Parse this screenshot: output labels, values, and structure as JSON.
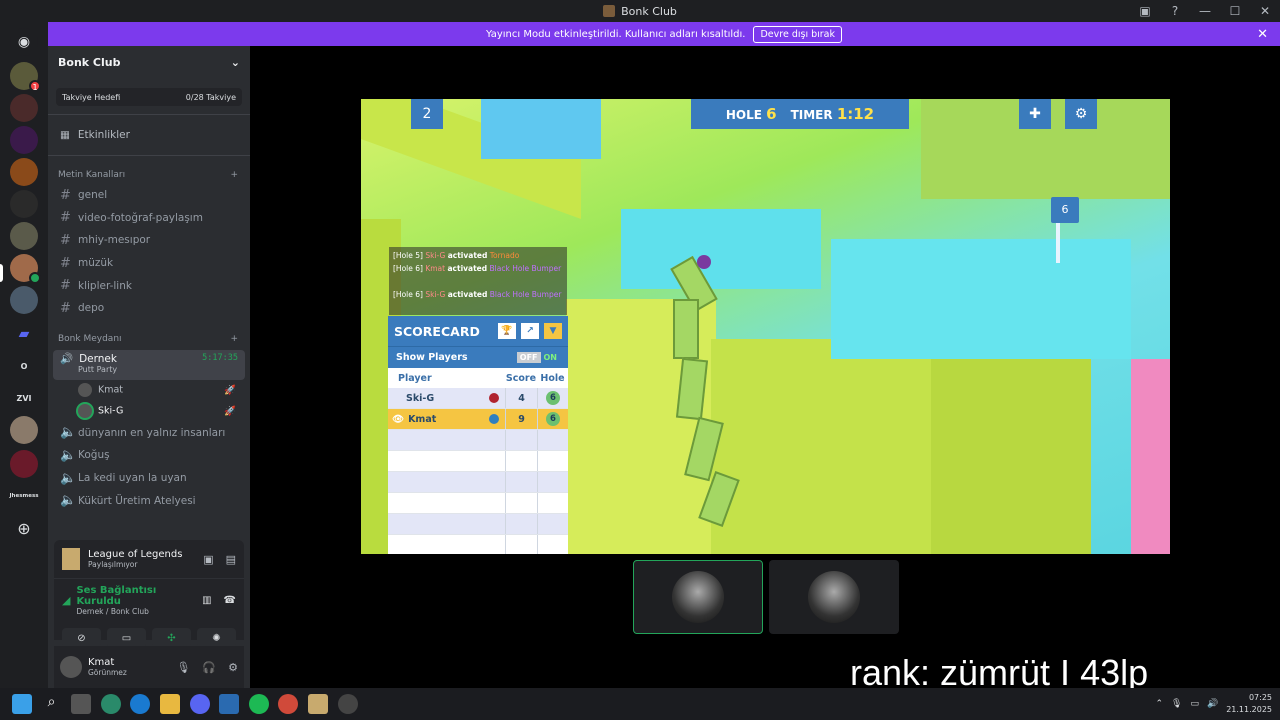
{
  "window": {
    "title": "Bonk Club",
    "controls": [
      "—",
      "☐",
      "✕"
    ]
  },
  "banner": {
    "message": "Yayıncı Modu etkinleştirildi. Kullanıcı adları kısaltıldı.",
    "button": "Devre dışı bırak"
  },
  "guilds": {
    "text_items": [
      "O",
      "ZVI",
      "Jhesmess"
    ]
  },
  "server": {
    "name": "Bonk Club",
    "boost_label": "Takviye Hedefi",
    "boost_value": "0/28 Takviye",
    "events_label": "Etkinlikler",
    "text_category": "Metin Kanalları",
    "text_channels": [
      "genel",
      "video-fotoğraf-paylaşım",
      "mhiy-mesıpor",
      "müzük",
      "klipler-link",
      "depo"
    ],
    "voice_category": "Bonk Meydanı",
    "active_voice": {
      "name": "Dernek",
      "activity": "Putt Party",
      "timer": "5:17:35"
    },
    "voice_users": [
      "Kmat",
      "Ski-G"
    ],
    "voice_channels": [
      "dünyanın en yalnız insanları",
      "Koğuş",
      "La kedi uyan la uyan",
      "Kükürt Üretim Atelyesi"
    ]
  },
  "activity": {
    "game": "League of Legends",
    "status": "Paylaşılmıyor"
  },
  "connection": {
    "status": "Ses Bağlantısı Kuruldu",
    "location": "Dernek / Bonk Club"
  },
  "user": {
    "name": "Kmat",
    "status": "Görünmez"
  },
  "game": {
    "hole_label": "HOLE",
    "hole_value": "6",
    "timer_label": "TIMER",
    "timer_value": "1:12",
    "player_count": "2",
    "log": [
      {
        "hole": "[Hole 5]",
        "player": "Ski-G",
        "verb": "activated",
        "ability": "Tornado"
      },
      {
        "hole": "[Hole 6]",
        "player": "Kmat",
        "verb": "activated",
        "ability": "Black Hole Bumper"
      },
      {
        "hole": "[Hole 6]",
        "player": "Ski-G",
        "verb": "activated",
        "ability": "Black Hole Bumper"
      }
    ],
    "scorecard": {
      "title": "SCORECARD",
      "show_players": "Show Players",
      "off": "OFF",
      "on": "ON",
      "headers": {
        "player": "Player",
        "score": "Score",
        "hole": "Hole"
      },
      "rows": [
        {
          "name": "Ski-G",
          "color": "#b0232f",
          "score": "4",
          "hole": "6"
        },
        {
          "name": "Kmat",
          "color": "#2f7fbf",
          "score": "9",
          "hole": "6"
        }
      ]
    },
    "flag_label": "6"
  },
  "overlay": {
    "rank_text": "rank: zümrüt I 43lp"
  },
  "taskbar": {
    "time": "07:25",
    "date": "21.11.2025"
  },
  "colors": {
    "banner": "#7c3aed",
    "hud": "#3a7bbd",
    "green": "#23a55a"
  }
}
